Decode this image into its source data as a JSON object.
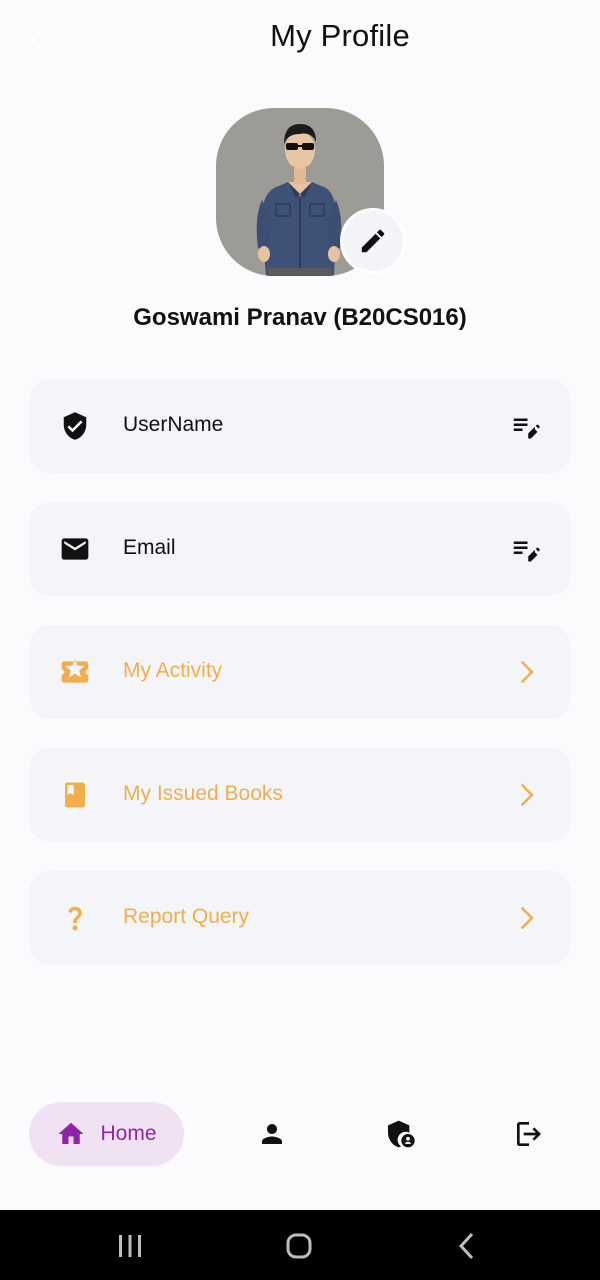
{
  "header": {
    "title": "My Profile",
    "back_icon": "arrow-left-icon"
  },
  "profile": {
    "name": "Goswami Pranav (B20CS016)",
    "avatar_bg": "#9c9b96",
    "edit_icon": "pencil-icon"
  },
  "menu": {
    "items": [
      {
        "label": "UserName",
        "icon": "shield-check-icon",
        "trailing": "edit-note-icon",
        "color": "#111111"
      },
      {
        "label": "Email",
        "icon": "mail-icon",
        "trailing": "edit-note-icon",
        "color": "#111111"
      },
      {
        "label": "My Activity",
        "icon": "ticket-star-icon",
        "trailing": "chevron-right-icon",
        "color": "#f2ad4c"
      },
      {
        "label": "My Issued Books",
        "icon": "book-icon",
        "trailing": "chevron-right-icon",
        "color": "#f2ad4c"
      },
      {
        "label": "Report Query",
        "icon": "question-mark-icon",
        "trailing": "chevron-right-icon",
        "color": "#f2ad4c"
      }
    ]
  },
  "bottom_nav": {
    "home_label": "Home",
    "items": [
      "home-icon",
      "person-icon",
      "admin-shield-icon",
      "logout-icon"
    ],
    "active_color": "#8e24aa",
    "active_bg": "#f1e2f3"
  },
  "system_nav": {
    "items": [
      "recents-icon",
      "home-circle-icon",
      "back-chevron-icon"
    ]
  },
  "colors": {
    "accent": "#f2ad4c",
    "card_bg": "#f4f5f9",
    "page_bg": "#fbfbfd"
  }
}
